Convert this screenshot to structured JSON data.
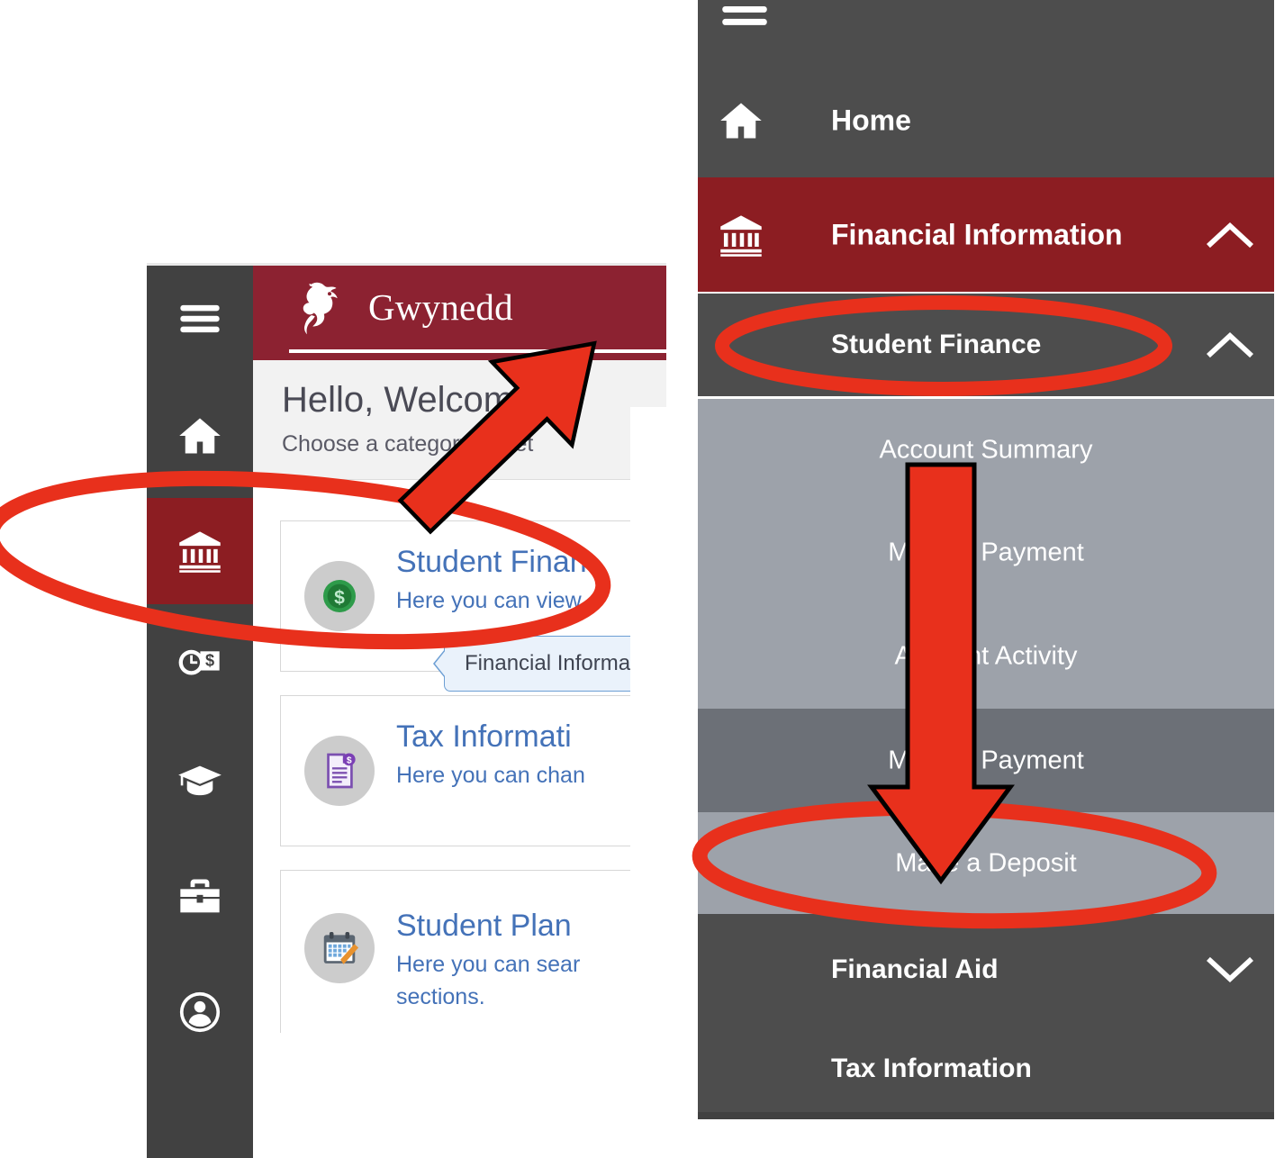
{
  "colors": {
    "brand_maroon": "#8C2231",
    "nav_active_red": "#8C1D22",
    "rail_dark": "#414141",
    "menu_dark": "#4d4d4d",
    "submenu_light": "#9da2aa",
    "submenu_dark": "#6c7077",
    "annotation_red": "#e8301c",
    "link_blue": "#4472b8"
  },
  "left_panel": {
    "rail": {
      "menu_icon": "hamburger-menu-icon",
      "items": [
        {
          "icon": "home-icon",
          "name": "home",
          "active": false
        },
        {
          "icon": "bank-icon",
          "name": "financial-information",
          "active": true
        },
        {
          "icon": "clock-dollar-icon",
          "name": "employment",
          "active": false
        },
        {
          "icon": "graduation-cap-icon",
          "name": "academics",
          "active": false
        },
        {
          "icon": "toolbox-icon",
          "name": "resources",
          "active": false
        },
        {
          "icon": "user-circle-icon",
          "name": "user-profile",
          "active": false
        }
      ]
    },
    "header": {
      "logo": "griffin-logo",
      "brand": "Gwynedd"
    },
    "greeting": {
      "title": "Hello, Welcome to",
      "subtitle": "Choose a category to get"
    },
    "tooltip": {
      "text": "Financial Information"
    },
    "cards": [
      {
        "icon": "money-circle-icon",
        "title": "Student Finan",
        "desc": "Here you can view"
      },
      {
        "icon": "tax-document-icon",
        "title": "Tax Informati",
        "desc": "Here you can chan"
      },
      {
        "icon": "calendar-check-icon",
        "title": "Student Plan",
        "desc": "Here you can sear",
        "desc2": "sections."
      }
    ]
  },
  "right_panel": {
    "menu_icon": "hamburger-menu-icon",
    "items": [
      {
        "label": "Home",
        "icon": "home-icon",
        "state": "default",
        "chevron": ""
      },
      {
        "label": "Financial Information",
        "icon": "bank-icon",
        "state": "active",
        "chevron": "chevron-up-icon"
      },
      {
        "label": "Student Finance",
        "icon": "",
        "state": "expanded",
        "chevron": "chevron-up-icon"
      },
      {
        "label": "Financial Aid",
        "icon": "",
        "state": "collapsed",
        "chevron": "chevron-down-icon"
      },
      {
        "label": "Tax Information",
        "icon": "",
        "state": "default",
        "chevron": ""
      }
    ],
    "student_finance_submenu": [
      {
        "label": "Account Summary",
        "shade": "light"
      },
      {
        "label": "Make a Payment",
        "shade": "light"
      },
      {
        "label": "Account Activity",
        "shade": "light"
      },
      {
        "label": "Make a Payment",
        "shade": "dark"
      },
      {
        "label": "Make a Deposit",
        "shade": "light"
      }
    ]
  },
  "annotations": {
    "ellipse_financial_information_rail": "red-ellipse",
    "ellipse_student_finance": "red-ellipse",
    "ellipse_make_a_deposit": "red-ellipse",
    "arrow_diagonal": "red-arrow-up-right",
    "arrow_vertical": "red-arrow-down"
  }
}
